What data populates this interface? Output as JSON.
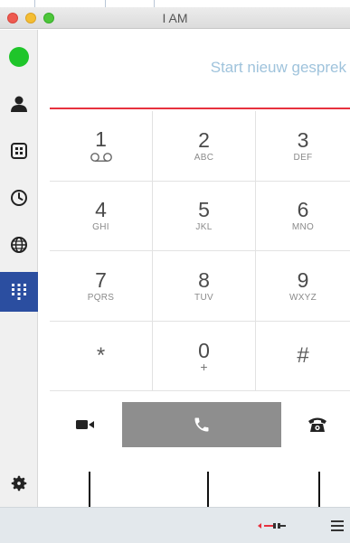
{
  "window": {
    "title": "I AM"
  },
  "dialer": {
    "placeholder": "Start nieuw gesprek"
  },
  "keypad": [
    {
      "digit": "1",
      "letters": ""
    },
    {
      "digit": "2",
      "letters": "ABC"
    },
    {
      "digit": "3",
      "letters": "DEF"
    },
    {
      "digit": "4",
      "letters": "GHI"
    },
    {
      "digit": "5",
      "letters": "JKL"
    },
    {
      "digit": "6",
      "letters": "MNO"
    },
    {
      "digit": "7",
      "letters": "PQRS"
    },
    {
      "digit": "8",
      "letters": "TUV"
    },
    {
      "digit": "9",
      "letters": "WXYZ"
    },
    {
      "digit": "*",
      "letters": ""
    },
    {
      "digit": "0",
      "letters": "+"
    },
    {
      "digit": "#",
      "letters": ""
    }
  ],
  "sidebar": {
    "items": [
      {
        "name": "status",
        "icon": "status-dot-icon"
      },
      {
        "name": "contacts",
        "icon": "person-icon"
      },
      {
        "name": "directory",
        "icon": "building-icon"
      },
      {
        "name": "history",
        "icon": "clock-icon"
      },
      {
        "name": "web",
        "icon": "globe-icon"
      },
      {
        "name": "dialpad",
        "icon": "dialpad-icon",
        "active": true
      }
    ]
  },
  "colors": {
    "accent": "#2b4ea0",
    "status": "#1fc52a",
    "divider": "#e7313e",
    "call_button": "#8e8e8e"
  }
}
